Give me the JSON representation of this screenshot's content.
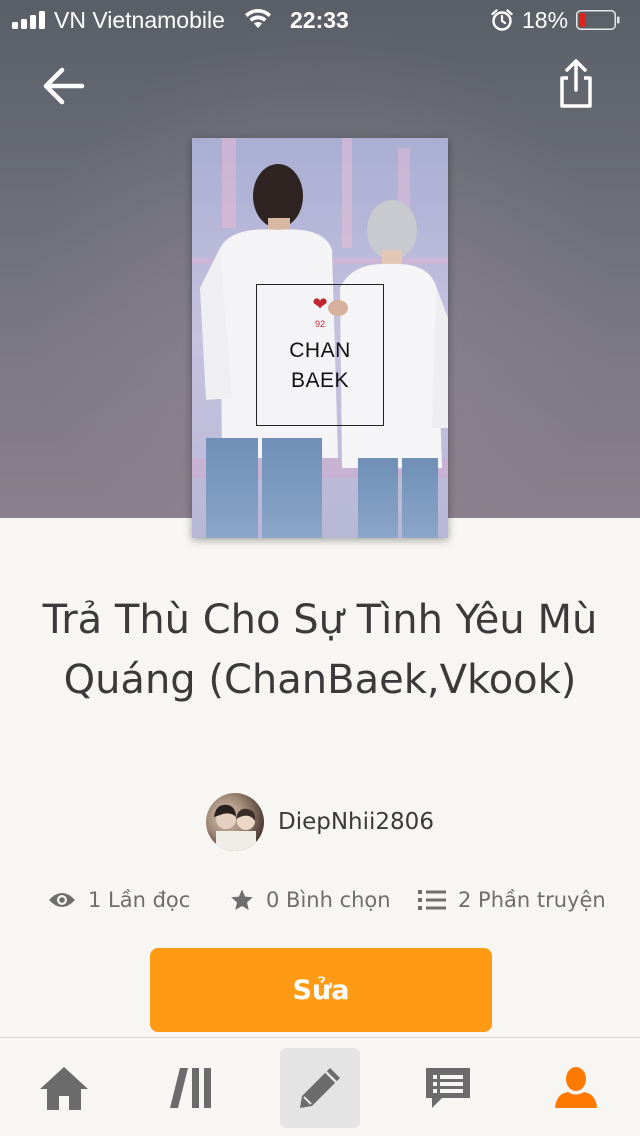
{
  "status_bar": {
    "carrier": "VN Vietnamobile",
    "time": "22:33",
    "battery": "18%",
    "battery_level": 0.18,
    "battery_color": "#e0231c"
  },
  "header": {
    "back_icon": "arrow-left-icon",
    "share_icon": "share-icon"
  },
  "cover": {
    "heart": "❤",
    "number": "92",
    "line1": "CHAN",
    "line2": "BAEK"
  },
  "story": {
    "title": "Trả Thù Cho Sự Tình Yêu Mù Quáng (ChanBaek,Vkook)",
    "author": "DiepNhii2806"
  },
  "stats": {
    "reads": "1 Lần đọc",
    "votes": "0 Bình chọn",
    "parts": "2 Phần truyện"
  },
  "actions": {
    "edit_label": "Sửa"
  },
  "bottom_nav": {
    "items": [
      {
        "icon": "home-icon"
      },
      {
        "icon": "library-icon"
      },
      {
        "icon": "pencil-icon"
      },
      {
        "icon": "messages-icon"
      },
      {
        "icon": "profile-icon"
      }
    ],
    "active_color": "#ff7a00",
    "inactive_color": "#6b6b6b"
  }
}
